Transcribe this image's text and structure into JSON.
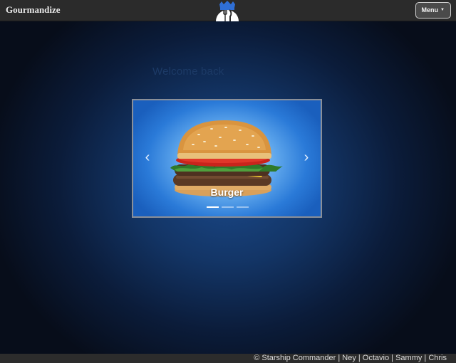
{
  "navbar": {
    "brand": "Gourmandize",
    "menu_label": "Menu",
    "logo_icon": "crown-fork-knife-icon"
  },
  "main": {
    "welcome": "Welcome back"
  },
  "carousel": {
    "slides": [
      {
        "caption": "Burger",
        "image": "burger-image"
      }
    ],
    "active_index": 0,
    "indicator_count": 3,
    "prev_icon": "chevron-left-icon",
    "next_icon": "chevron-right-icon"
  },
  "footer": {
    "text": "© Starship Commander | Ney | Octavio | Sammy | Chris"
  },
  "colors": {
    "navbar_bg": "#2b2b2b",
    "footer_bg": "#2c2c2c",
    "background_center": "#1b4a8c",
    "background_edge": "#070d1a"
  }
}
